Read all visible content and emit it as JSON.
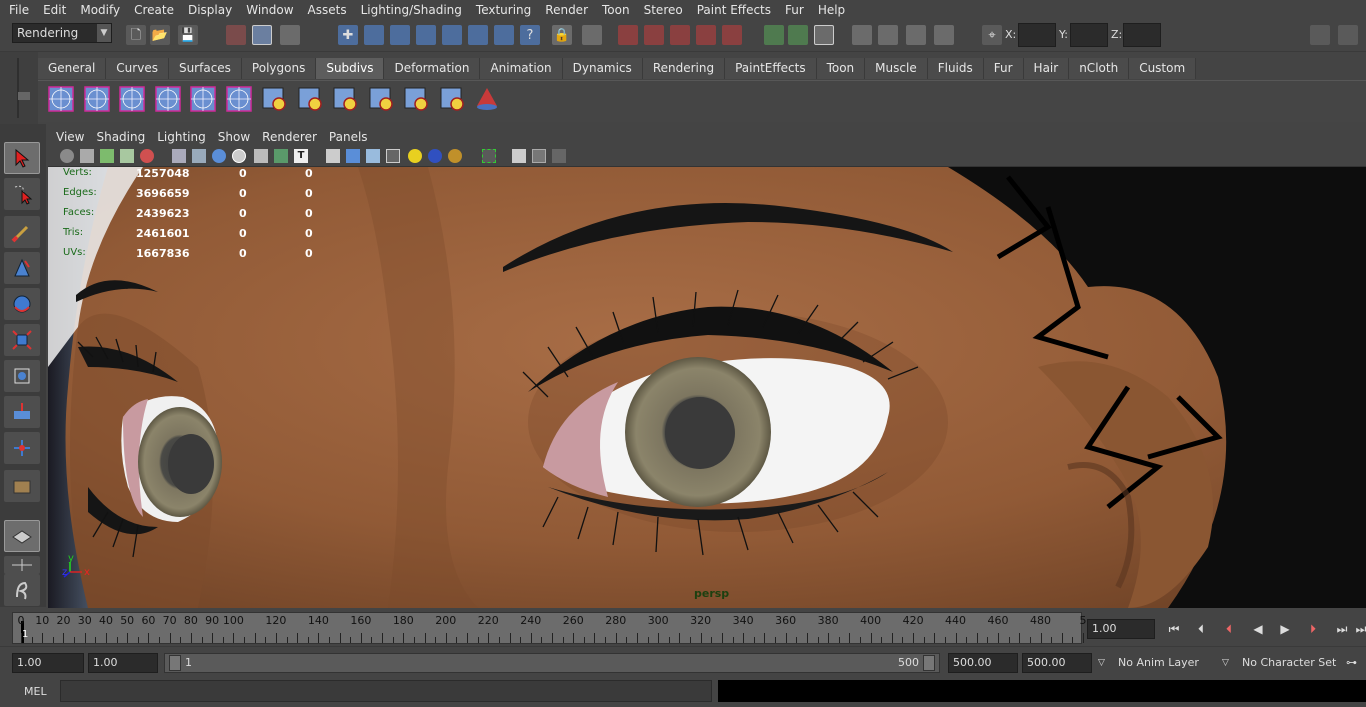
{
  "menubar": {
    "items": [
      "File",
      "Edit",
      "Modify",
      "Create",
      "Display",
      "Window",
      "Assets",
      "Lighting/Shading",
      "Texturing",
      "Render",
      "Toon",
      "Stereo",
      "Paint Effects",
      "Fur",
      "Help"
    ]
  },
  "statusline": {
    "mode": "Rendering",
    "x_label": "X:",
    "y_label": "Y:",
    "z_label": "Z:"
  },
  "shelf": {
    "tabs": [
      "General",
      "Curves",
      "Surfaces",
      "Polygons",
      "Subdivs",
      "Deformation",
      "Animation",
      "Dynamics",
      "Rendering",
      "PaintEffects",
      "Toon",
      "Muscle",
      "Fluids",
      "Fur",
      "Hair",
      "nCloth",
      "Custom"
    ],
    "active_tab": "Subdivs",
    "icons": [
      "subdiv-sphere-icon",
      "subdiv-cube-icon",
      "subdiv-cylinder-icon",
      "subdiv-cone-icon",
      "subdiv-plane-icon",
      "subdiv-torus-icon",
      "subdiv-tool-icon",
      "subdiv-tool-icon",
      "subdiv-tool-icon",
      "subdiv-tool-icon",
      "subdiv-tool-icon",
      "subdiv-tool-icon"
    ]
  },
  "panel": {
    "menus": [
      "View",
      "Shading",
      "Lighting",
      "Show",
      "Renderer",
      "Panels"
    ]
  },
  "hud": {
    "rows": [
      {
        "label": "Verts:",
        "v1": "1257048",
        "v2": "0",
        "v3": "0"
      },
      {
        "label": "Edges:",
        "v1": "3696659",
        "v2": "0",
        "v3": "0"
      },
      {
        "label": "Faces:",
        "v1": "2439623",
        "v2": "0",
        "v3": "0"
      },
      {
        "label": "Tris:",
        "v1": "2461601",
        "v2": "0",
        "v3": "0"
      },
      {
        "label": "UVs:",
        "v1": "1667836",
        "v2": "0",
        "v3": "0"
      }
    ],
    "camera": "persp",
    "axis_y": "y",
    "axis_z": "z",
    "axis_x": "x"
  },
  "timeslider": {
    "ticks": [
      "0",
      "10",
      "20",
      "30",
      "40",
      "50",
      "60",
      "70",
      "80",
      "90",
      "100",
      "120",
      "140",
      "160",
      "180",
      "200",
      "220",
      "240",
      "260",
      "280",
      "300",
      "320",
      "340",
      "360",
      "380",
      "400",
      "420",
      "440",
      "460",
      "480",
      "5"
    ],
    "current_frame_marker": "1",
    "current_frame": "1.00"
  },
  "rangeslider": {
    "start_time": "1.00",
    "range_start": "1.00",
    "range_bar_start": "1",
    "range_bar_end": "500",
    "range_end": "500.00",
    "end_time": "500.00",
    "anim_layer": "No Anim Layer",
    "character_set": "No Character Set"
  },
  "cmdline": {
    "label": "MEL"
  },
  "colors": {
    "skin": "#8a5a3a",
    "hud_label": "#1b6b1b",
    "ui_bg": "#444444"
  }
}
